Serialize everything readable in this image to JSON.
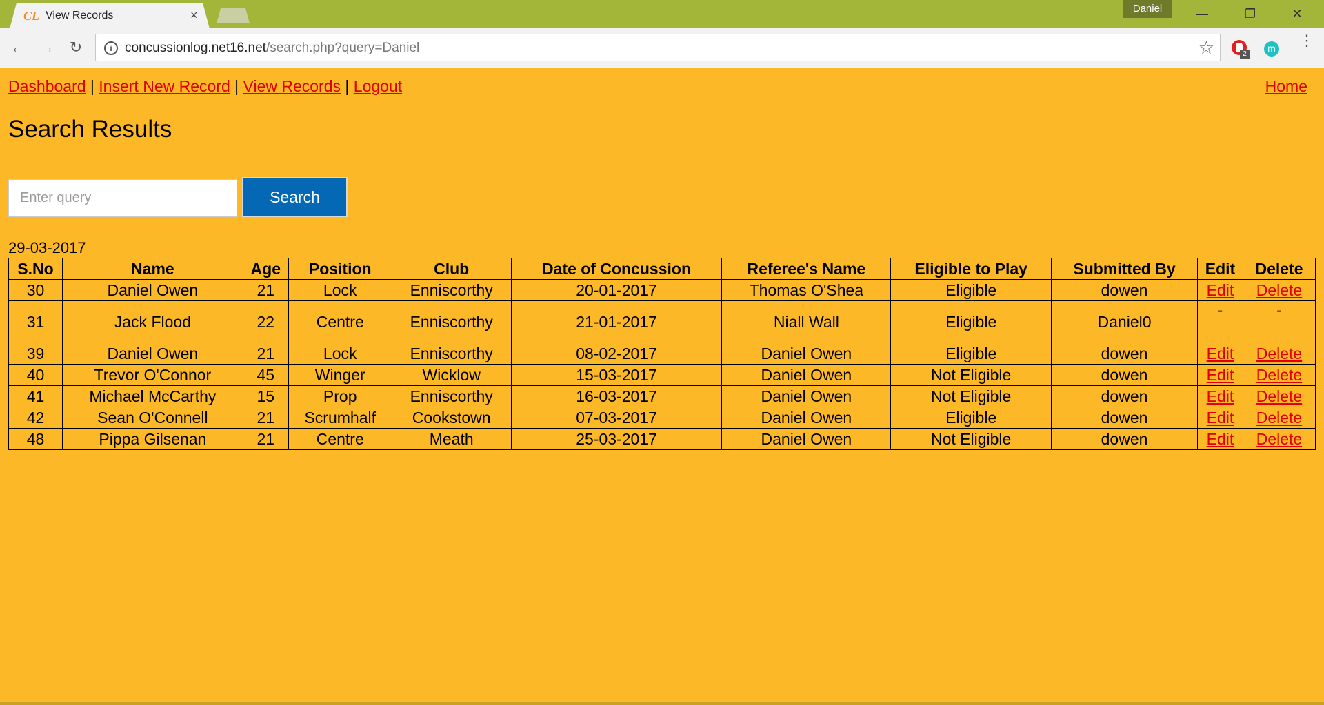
{
  "browser": {
    "tab_title": "View Records",
    "favicon_text": "CL",
    "tab_close": "×",
    "profile_name": "Daniel",
    "url_domain": "concussionlog.net16.net",
    "url_path": "/search.php?query=Daniel",
    "extension_badge": "2",
    "extension_letter": "m"
  },
  "nav": {
    "links": [
      "Dashboard",
      "Insert New Record",
      "View Records",
      "Logout"
    ],
    "separator": "|",
    "home": "Home"
  },
  "page": {
    "title": "Search Results",
    "search_placeholder": "Enter query",
    "search_button": "Search",
    "date": "29-03-2017"
  },
  "table": {
    "headers": [
      "S.No",
      "Name",
      "Age",
      "Position",
      "Club",
      "Date of Concussion",
      "Referee's Name",
      "Eligible to Play",
      "Submitted By",
      "Edit",
      "Delete"
    ],
    "rows": [
      {
        "sno": "30",
        "name": "Daniel Owen",
        "age": "21",
        "position": "Lock",
        "club": "Enniscorthy",
        "date": "20-01-2017",
        "referee": "Thomas O'Shea",
        "eligible": "Eligible",
        "submitted_by": "dowen",
        "edit": "Edit",
        "delete": "Delete"
      },
      {
        "sno": "31",
        "name": "Jack Flood",
        "age": "22",
        "position": "Centre",
        "club": "Enniscorthy",
        "date": "21-01-2017",
        "referee": "Niall Wall",
        "eligible": "Eligible",
        "submitted_by": "Daniel0",
        "edit": "-",
        "delete": "-"
      },
      {
        "sno": "39",
        "name": "Daniel Owen",
        "age": "21",
        "position": "Lock",
        "club": "Enniscorthy",
        "date": "08-02-2017",
        "referee": "Daniel Owen",
        "eligible": "Eligible",
        "submitted_by": "dowen",
        "edit": "Edit",
        "delete": "Delete"
      },
      {
        "sno": "40",
        "name": "Trevor O'Connor",
        "age": "45",
        "position": "Winger",
        "club": "Wicklow",
        "date": "15-03-2017",
        "referee": "Daniel Owen",
        "eligible": "Not Eligible",
        "submitted_by": "dowen",
        "edit": "Edit",
        "delete": "Delete"
      },
      {
        "sno": "41",
        "name": "Michael McCarthy",
        "age": "15",
        "position": "Prop",
        "club": "Enniscorthy",
        "date": "16-03-2017",
        "referee": "Daniel Owen",
        "eligible": "Not Eligible",
        "submitted_by": "dowen",
        "edit": "Edit",
        "delete": "Delete"
      },
      {
        "sno": "42",
        "name": "Sean O'Connell",
        "age": "21",
        "position": "Scrumhalf",
        "club": "Cookstown",
        "date": "07-03-2017",
        "referee": "Daniel Owen",
        "eligible": "Eligible",
        "submitted_by": "dowen",
        "edit": "Edit",
        "delete": "Delete"
      },
      {
        "sno": "48",
        "name": "Pippa Gilsenan",
        "age": "21",
        "position": "Centre",
        "club": "Meath",
        "date": "25-03-2017",
        "referee": "Daniel Owen",
        "eligible": "Not Eligible",
        "submitted_by": "dowen",
        "edit": "Edit",
        "delete": "Delete"
      }
    ]
  },
  "colors": {
    "page_background": "#FDB827",
    "link": "#E00000",
    "button": "#0468B4",
    "chrome_frame": "#A4B63A"
  }
}
